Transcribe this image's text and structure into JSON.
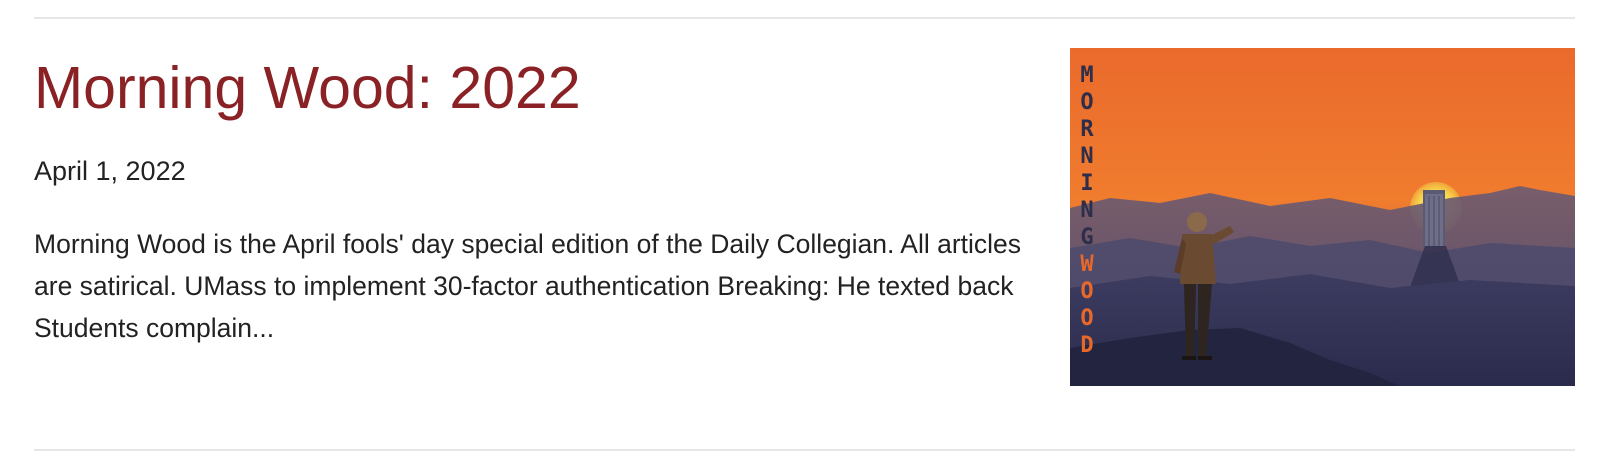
{
  "article": {
    "title": "Morning Wood: 2022",
    "date": "April 1, 2022",
    "excerpt": "Morning Wood is the April fools' day special edition of the Daily Collegian. All articles are satirical.  UMass to implement 30-factor authentication Breaking: He texted back Students complain...",
    "title_color": "#8a2125"
  },
  "thumbnail": {
    "word_top": [
      "M",
      "O",
      "R",
      "N",
      "I",
      "N",
      "G"
    ],
    "word_bottom": [
      "W",
      "O",
      "O",
      "D"
    ],
    "colors": {
      "sky_top": "#ec6a2a",
      "sky_bottom": "#f08a32",
      "mountains": "#3a3a5c",
      "sun": "#f5e15a",
      "letters_dark": "#2e2d4a",
      "letters_orange": "#e8682a"
    }
  }
}
